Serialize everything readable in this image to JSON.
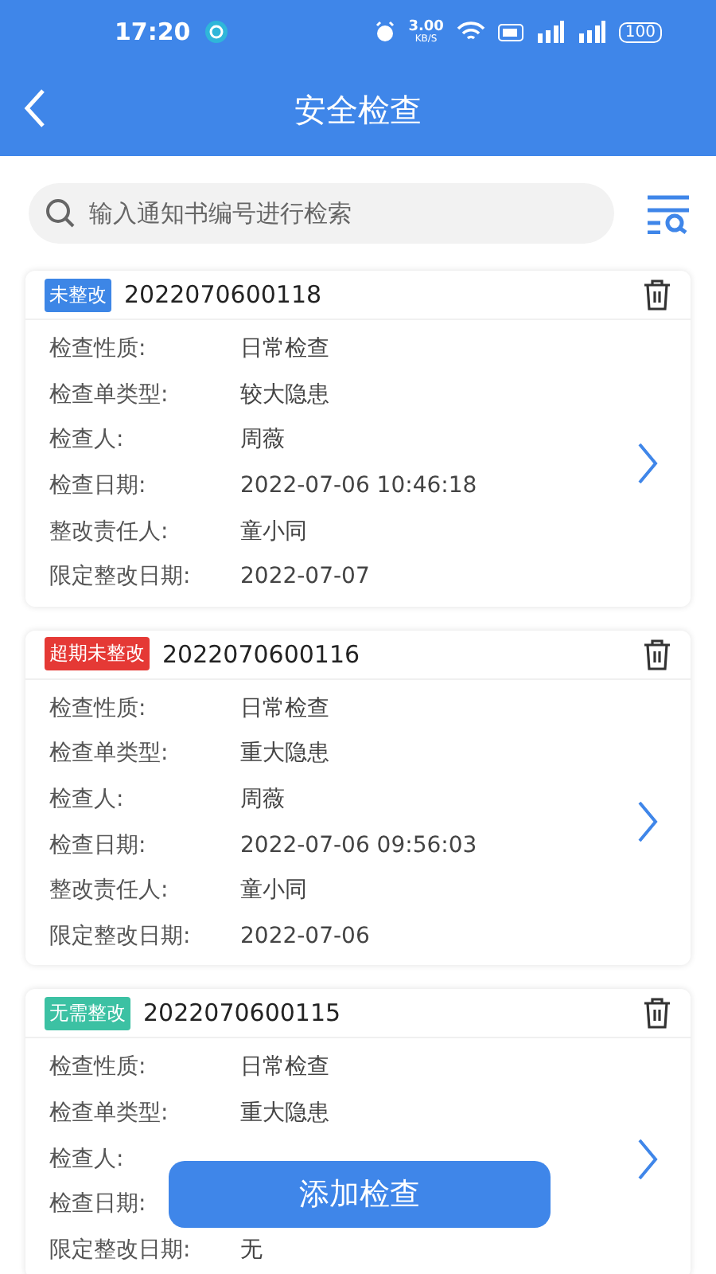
{
  "status_bar": {
    "time": "17:20",
    "net_speed": "3.00",
    "net_unit": "KB/S",
    "battery": "100"
  },
  "header": {
    "title": "安全检查"
  },
  "search": {
    "placeholder": "输入通知书编号进行检索"
  },
  "records": [
    {
      "status": {
        "label": "未整改",
        "color": "#3d86e6"
      },
      "number": "2022070600118",
      "fields": [
        {
          "label": "检查性质:",
          "value": "日常检查"
        },
        {
          "label": "检查单类型:",
          "value": "较大隐患"
        },
        {
          "label": "检查人:",
          "value": "周薇"
        },
        {
          "label": "检查日期:",
          "value": "2022-07-06 10:46:18"
        },
        {
          "label": "整改责任人:",
          "value": "童小同"
        },
        {
          "label": "限定整改日期:",
          "value": "2022-07-07"
        }
      ]
    },
    {
      "status": {
        "label": "超期未整改",
        "color": "#e53935"
      },
      "number": "2022070600116",
      "fields": [
        {
          "label": "检查性质:",
          "value": "日常检查"
        },
        {
          "label": "检查单类型:",
          "value": "重大隐患"
        },
        {
          "label": "检查人:",
          "value": "周薇"
        },
        {
          "label": "检查日期:",
          "value": "2022-07-06 09:56:03"
        },
        {
          "label": "整改责任人:",
          "value": "童小同"
        },
        {
          "label": "限定整改日期:",
          "value": "2022-07-06"
        }
      ]
    },
    {
      "status": {
        "label": "无需整改",
        "color": "#3cc1a3"
      },
      "number": "2022070600115",
      "fields": [
        {
          "label": "检查性质:",
          "value": "日常检查"
        },
        {
          "label": "检查单类型:",
          "value": "重大隐患"
        },
        {
          "label": "检查人:"
        },
        {
          "label": "检查日期:"
        },
        {
          "label": "限定整改日期:",
          "value": "无"
        }
      ]
    }
  ],
  "add_button": "添加检查"
}
